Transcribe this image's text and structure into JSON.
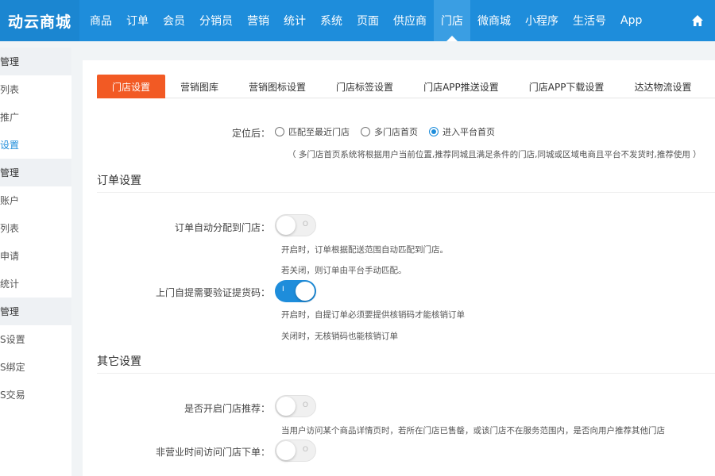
{
  "brand": "动云商城",
  "nav": [
    "商品",
    "订单",
    "会员",
    "分销员",
    "营销",
    "统计",
    "系统",
    "页面",
    "供应商",
    "门店",
    "微商城",
    "小程序",
    "生活号",
    "App"
  ],
  "nav_active_index": 9,
  "sidebar": [
    {
      "label": "管理",
      "group": true
    },
    {
      "label": "列表",
      "group": false
    },
    {
      "label": "推广",
      "group": false
    },
    {
      "label": "设置",
      "group": false,
      "active": true
    },
    {
      "label": "管理",
      "group": true
    },
    {
      "label": "账户",
      "group": false
    },
    {
      "label": "列表",
      "group": false
    },
    {
      "label": "申请",
      "group": false
    },
    {
      "label": "统计",
      "group": false
    },
    {
      "label": "管理",
      "group": true
    },
    {
      "label": "S设置",
      "group": false
    },
    {
      "label": "S绑定",
      "group": false
    },
    {
      "label": "S交易",
      "group": false
    }
  ],
  "tabs": [
    "门店设置",
    "营销图库",
    "营销图标设置",
    "门店标签设置",
    "门店APP推送设置",
    "门店APP下载设置",
    "达达物流设置"
  ],
  "tab_active_index": 0,
  "location": {
    "label": "定位后：",
    "options": [
      "匹配至最近门店",
      "多门店首页",
      "进入平台首页"
    ],
    "selected_index": 2,
    "hint": "（ 多门店首页系统将根据用户当前位置,推荐同城且满足条件的门店,同城或区域电商且平台不发货时,推荐使用 ）"
  },
  "order_section": {
    "title": "订单设置",
    "auto_assign": {
      "label": "订单自动分配到门店：",
      "on": false,
      "hint1": "开启时，订单根据配送范围自动匹配到门店。",
      "hint2": "若关闭，则订单由平台手动匹配。"
    },
    "pickup_verify": {
      "label": "上门自提需要验证提货码：",
      "on": true,
      "hint1": "开启时，自提订单必须要提供核销码才能核销订单",
      "hint2": "关闭时，无核销码也能核销订单"
    }
  },
  "other_section": {
    "title": "其它设置",
    "recommend": {
      "label": "是否开启门店推荐：",
      "on": false,
      "hint": "当用户访问某个商品详情页时，若所在门店已售罄，或该门店不在服务范围内，是否向用户推荐其他门店"
    },
    "off_hours": {
      "label": "非营业时间访问门店下单：",
      "on": false
    }
  },
  "toggle_on_mark": "I",
  "toggle_off_mark": "O",
  "colors": {
    "topbar": "#1e8ddb",
    "accent": "#f25a24",
    "primary": "#1e8ddb"
  }
}
